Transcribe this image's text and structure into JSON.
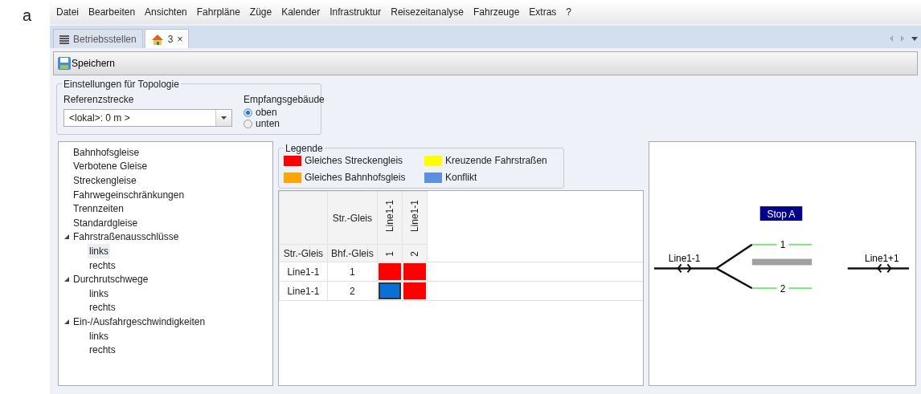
{
  "figure_label": "a",
  "menu": [
    "Datei",
    "Bearbeiten",
    "Ansichten",
    "Fahrpläne",
    "Züge",
    "Kalender",
    "Infrastruktur",
    "Reisezeitanalyse",
    "Fahrzeuge",
    "Extras",
    "?"
  ],
  "tabs": [
    {
      "kind": "list",
      "label": "Betriebsstellen",
      "selected": false
    },
    {
      "kind": "home",
      "label": "3",
      "selected": true,
      "close": "×"
    }
  ],
  "toolbar": {
    "save_button": "Speichern"
  },
  "settings": {
    "title": "Einstellungen für Topologie",
    "reference_label": "Referenzstrecke",
    "reference_value": "<lokal>: 0 m >",
    "building_label": "Empfangsgebäude",
    "building_options": [
      {
        "label": "oben",
        "selected": true
      },
      {
        "label": "unten",
        "selected": false
      }
    ]
  },
  "tree": [
    {
      "label": "Bahnhofsgleise",
      "selected": false
    },
    {
      "label": "Verbotene Gleise",
      "selected": false
    },
    {
      "label": "Streckengleise",
      "selected": false
    },
    {
      "label": "Fahrwegeinschränkungen",
      "selected": false
    },
    {
      "label": "Trennzeiten",
      "selected": false
    },
    {
      "label": "Standardgleise",
      "selected": false
    },
    {
      "label": "Fahrstraßenausschlüsse",
      "selected": false,
      "expanded": true,
      "children": [
        {
          "label": "links",
          "selected": true
        },
        {
          "label": "rechts",
          "selected": false
        }
      ]
    },
    {
      "label": "Durchrutschwege",
      "selected": false,
      "expanded": true,
      "children": [
        {
          "label": "links",
          "selected": false
        },
        {
          "label": "rechts",
          "selected": false
        }
      ]
    },
    {
      "label": "Ein-/Ausfahrgeschwindigkeiten",
      "selected": false,
      "expanded": true,
      "children": [
        {
          "label": "links",
          "selected": false
        },
        {
          "label": "rechts",
          "selected": false
        }
      ]
    }
  ],
  "legend": {
    "title": "Legende",
    "items": [
      {
        "label": "Gleiches Streckengleis",
        "color": "#ff0000"
      },
      {
        "label": "Kreuzende Fahrstraßen",
        "color": "#ffff00"
      },
      {
        "label": "Gleiches Bahnhofsgleis",
        "color": "#ffa500"
      },
      {
        "label": "Konflikt",
        "color": "#5b8fe0"
      }
    ]
  },
  "matrix": {
    "corner_header": "Str.-Gleis",
    "row_header_track": "Str.-Gleis",
    "row_header_number": "Bhf.-Gleis",
    "columns": [
      {
        "track": "Line1-1",
        "number": "1"
      },
      {
        "track": "Line1-1",
        "number": "2"
      }
    ],
    "rows": [
      {
        "track": "Line1-1",
        "number": "1",
        "cells": [
          {
            "color": "#ff0000",
            "selected": false
          },
          {
            "color": "#ff0000",
            "selected": false
          }
        ]
      },
      {
        "track": "Line1-1",
        "number": "2",
        "cells": [
          {
            "color": "#0a6fd6",
            "selected": true
          },
          {
            "color": "#ff0000",
            "selected": false
          }
        ]
      }
    ]
  },
  "diagram": {
    "station": "Stop A",
    "left_line": "Line1-1",
    "right_line": "Line1+1",
    "tracks": [
      "1",
      "2"
    ]
  }
}
